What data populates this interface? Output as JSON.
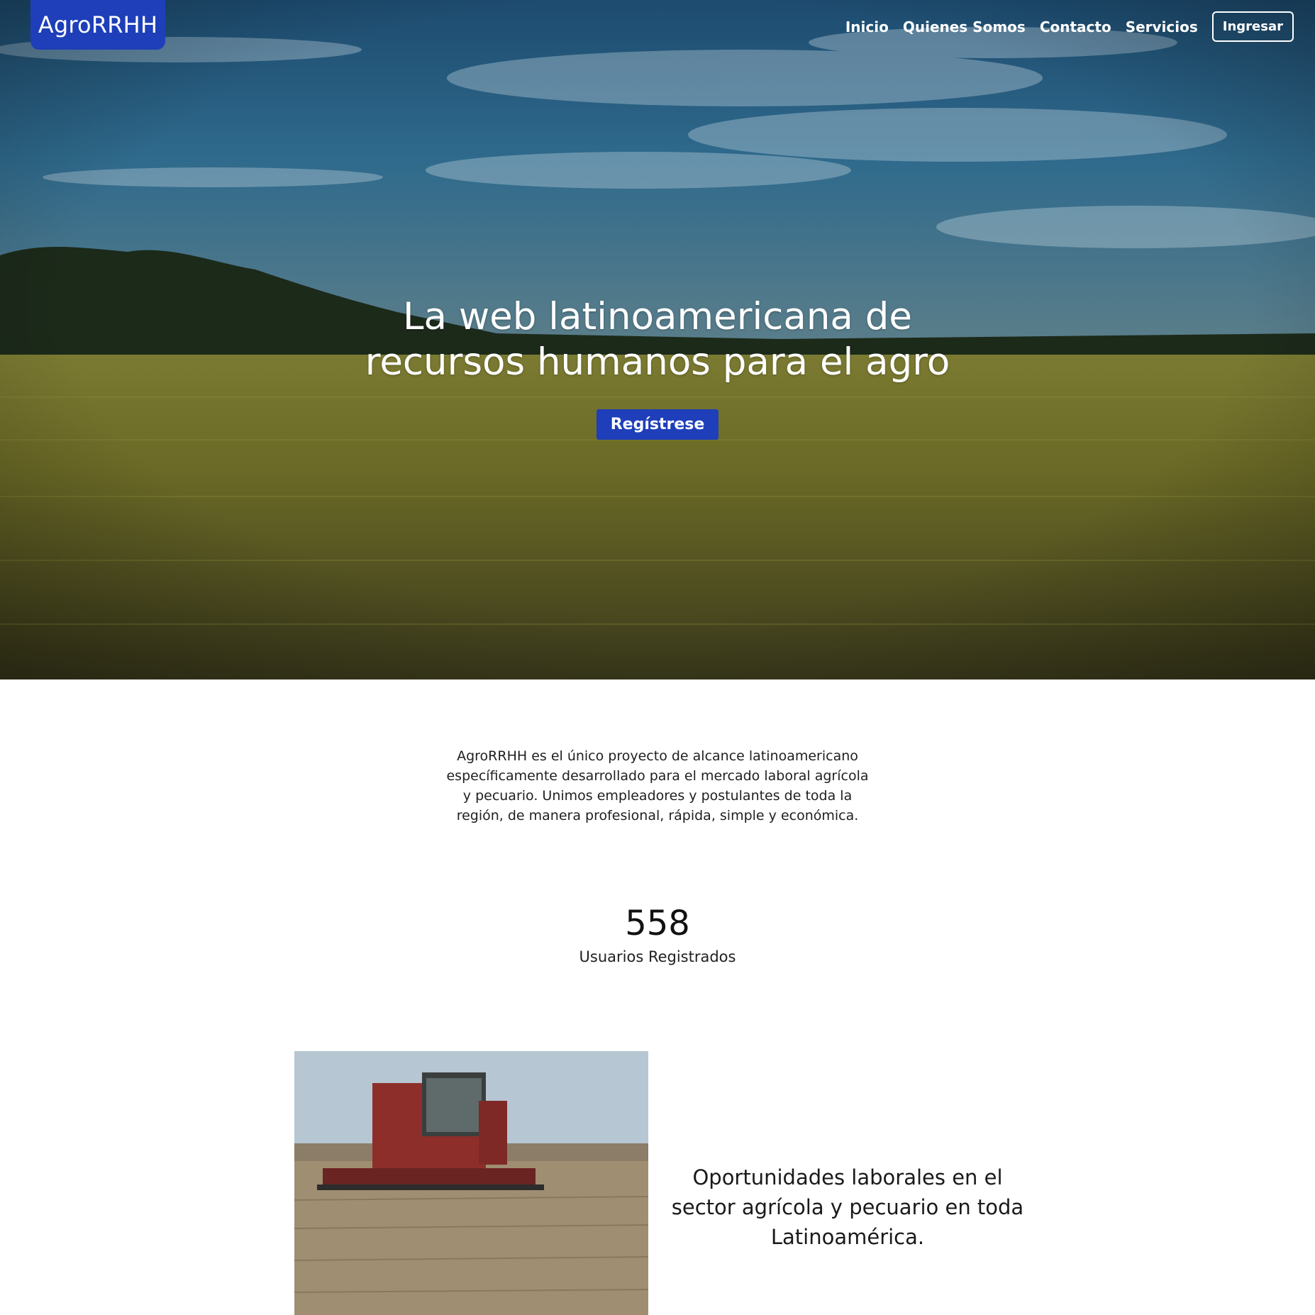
{
  "brand": {
    "name": "AgroRRHH"
  },
  "nav": {
    "items": [
      {
        "label": "Inicio"
      },
      {
        "label": "Quienes Somos"
      },
      {
        "label": "Contacto"
      },
      {
        "label": "Servicios"
      }
    ],
    "login_label": "Ingresar"
  },
  "hero": {
    "title": "La web latinoamericana de recursos humanos para el agro",
    "cta_label": "Regístrese"
  },
  "about": {
    "text": "AgroRRHH es el único proyecto de alcance latinoamericano específicamente desarrollado para el mercado laboral agrícola y pecuario. Unimos empleadores y postulantes de toda la región, de manera profesional, rápida, simple y económica."
  },
  "stats": {
    "value": "558",
    "label": "Usuarios Registrados"
  },
  "feature": {
    "text": "Oportunidades laborales en el sector agrícola y pecuario en toda Latinoamérica."
  },
  "colors": {
    "accent": "#1e3fb9",
    "text": "#1a1a1a",
    "hero_text": "#ffffff"
  }
}
